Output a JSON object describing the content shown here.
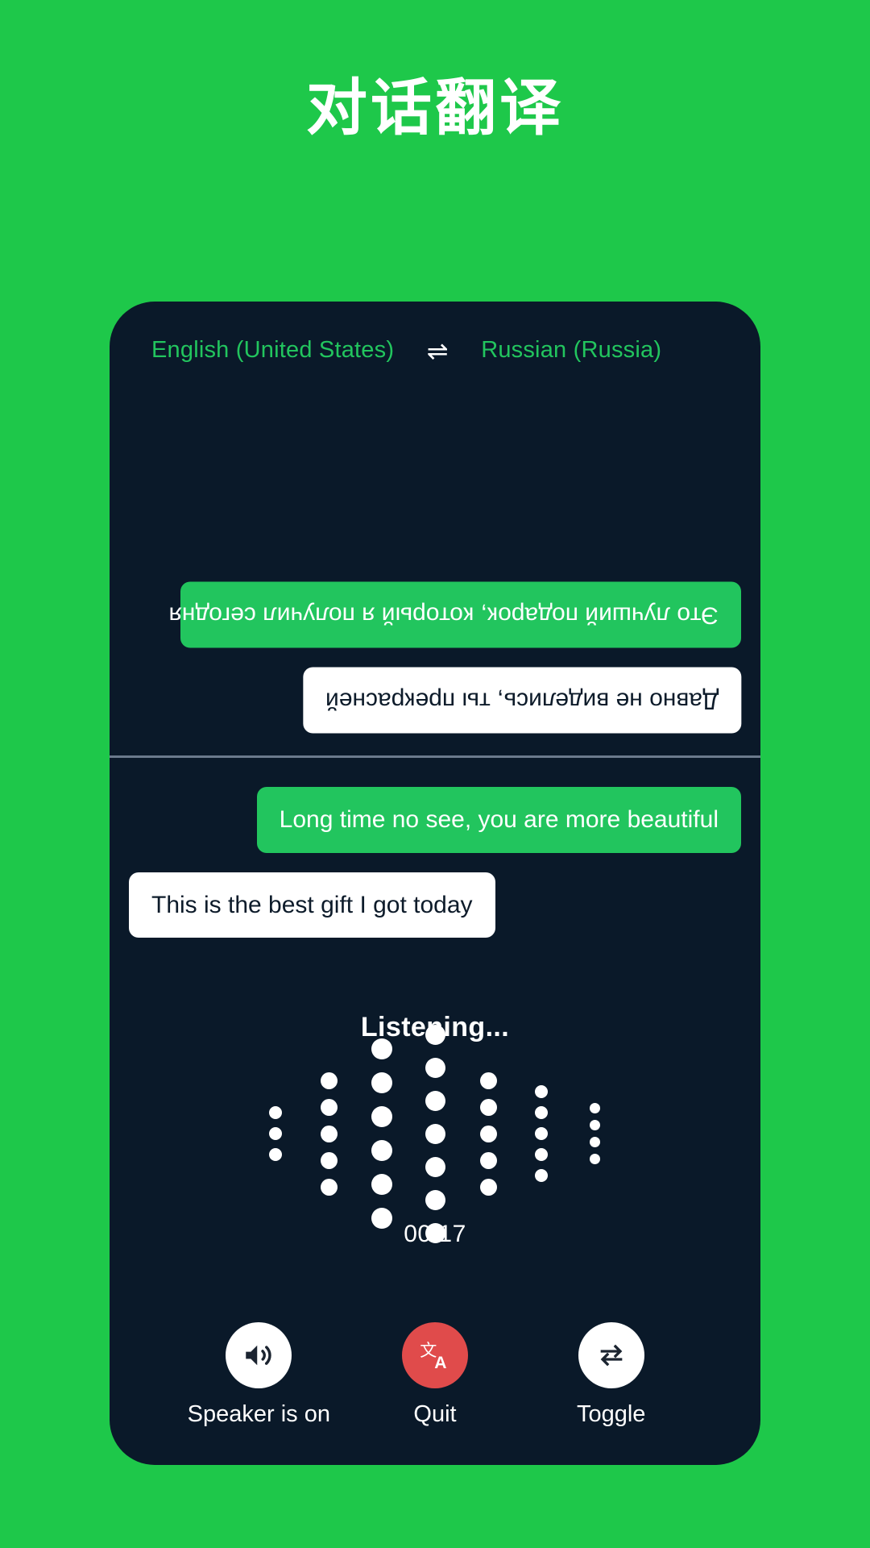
{
  "page": {
    "title": "对话翻译",
    "background_color": "#1ec84a"
  },
  "phone": {
    "background_color": "#0a1929",
    "language_bar": {
      "source_language": "English (United States)",
      "swap_icon": "swap-horizontal-icon",
      "swap_glyph": "⇌",
      "target_language": "Russian (Russia)",
      "text_color": "#22c55e"
    },
    "top_pane": {
      "messages": [
        {
          "text": "Это лучший подарок, который я получил сегодня",
          "style": "green",
          "align": "right",
          "rotated": true
        },
        {
          "text": "Давно не виделись, ты прекрасней",
          "style": "white",
          "align": "right",
          "rotated": true
        }
      ]
    },
    "bottom_pane": {
      "messages": [
        {
          "text": "Long time no see, you are more beautiful",
          "style": "green",
          "align": "right",
          "rotated": false
        },
        {
          "text": "This is the best gift I got today",
          "style": "white",
          "align": "left",
          "rotated": false
        }
      ]
    },
    "listening": {
      "status_text": "Listening...",
      "timer": "00:17",
      "visualizer": {
        "columns": [
          {
            "count": 3,
            "size": 16
          },
          {
            "count": 5,
            "size": 21
          },
          {
            "count": 6,
            "size": 26
          },
          {
            "count": 7,
            "size": 25
          },
          {
            "count": 5,
            "size": 21
          },
          {
            "count": 5,
            "size": 16
          },
          {
            "count": 4,
            "size": 13
          }
        ],
        "dot_color": "#ffffff"
      }
    },
    "controls": [
      {
        "label": "Speaker is on",
        "icon": "speaker-on-icon",
        "circle_color": "#ffffff",
        "icon_color": "#1b2430"
      },
      {
        "label": "Quit",
        "icon": "translate-icon",
        "circle_color": "#e04b4b",
        "icon_color": "#ffffff"
      },
      {
        "label": "Toggle",
        "icon": "swap-arrows-icon",
        "circle_color": "#ffffff",
        "icon_color": "#1b2430"
      }
    ]
  }
}
